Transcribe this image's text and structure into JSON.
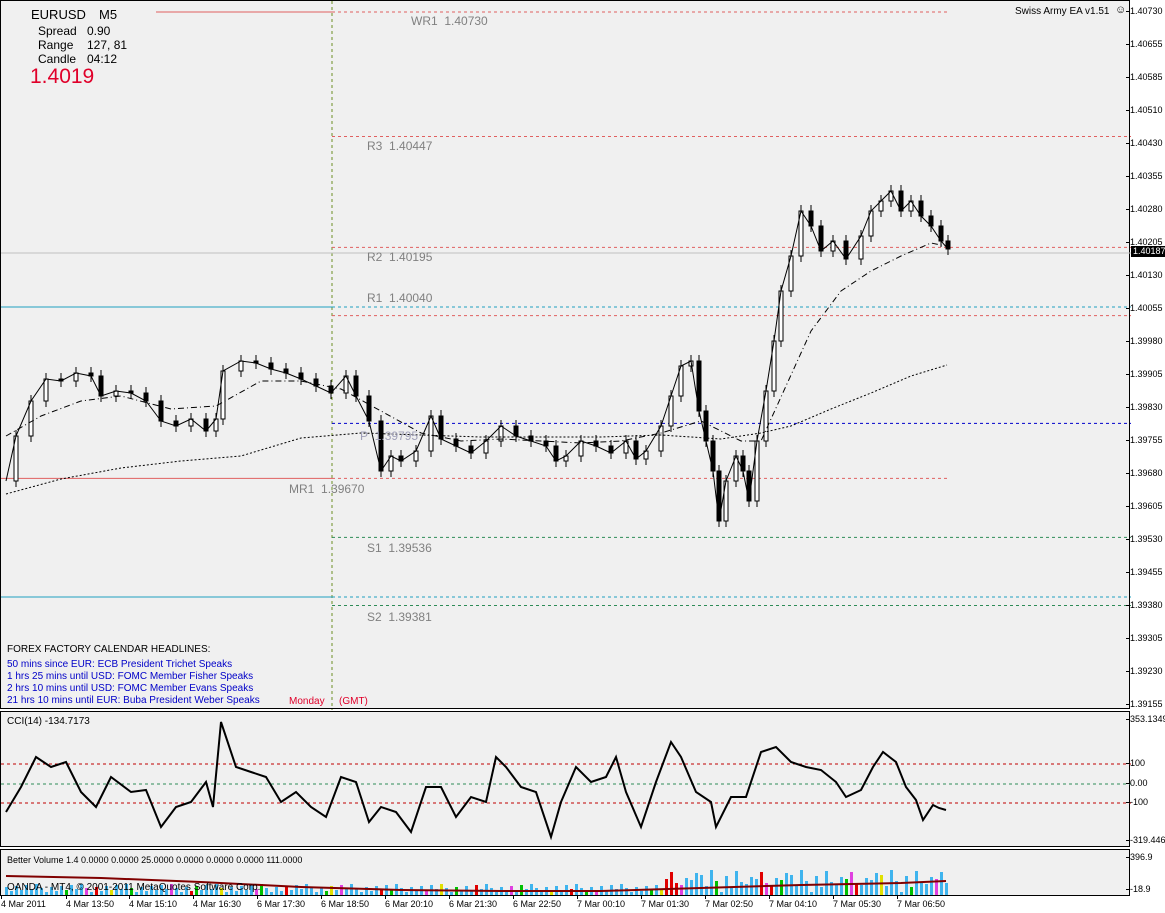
{
  "symbol": "EURUSD",
  "timeframe": "M5",
  "info": {
    "spread_label": "Spread",
    "spread_value": "0.90",
    "range_label": "Range",
    "range_value": "127, 81",
    "candle_label": "Candle",
    "candle_value": "04:12",
    "price": "1.4019"
  },
  "ea_label": "Swiss Army EA v1.51",
  "ea_icon": "smiley-icon",
  "levels": [
    {
      "name": "WR1",
      "value": "1.40730"
    },
    {
      "name": "R3",
      "value": "1.40447"
    },
    {
      "name": "R2",
      "value": "1.40195"
    },
    {
      "name": "R1",
      "value": "1.40040"
    },
    {
      "name": "P",
      "value": "1.39795"
    },
    {
      "name": "MR1",
      "value": "1.39670"
    },
    {
      "name": "S1",
      "value": "1.39536"
    },
    {
      "name": "S2",
      "value": "1.39381"
    }
  ],
  "calendar": {
    "title": "FOREX FACTORY CALENDAR  HEADLINES:",
    "items": [
      "50 mins since EUR: ECB President Trichet Speaks",
      "1 hrs 25 mins until USD: FOMC Member Fisher Speaks",
      "2 hrs 10 mins until USD: FOMC Member Evans Speaks",
      "21 hrs 10 mins until EUR: Buba President Weber Speaks"
    ],
    "day": "Monday",
    "tz": "(GMT)"
  },
  "price_axis": [
    "1.40730",
    "1.40655",
    "1.40585",
    "1.40510",
    "1.40430",
    "1.40355",
    "1.40280",
    "1.40205",
    "1.40130",
    "1.40055",
    "1.39980",
    "1.39905",
    "1.39830",
    "1.39755",
    "1.39680",
    "1.39605",
    "1.39530",
    "1.39455",
    "1.39380",
    "1.39305",
    "1.39230",
    "1.39155"
  ],
  "current_price_badge": "1.40187",
  "cci": {
    "label": "CCI(14) -134.7173",
    "axis": [
      "353.1349",
      "100",
      "0.00",
      "-100",
      "-319.446"
    ]
  },
  "volume": {
    "label": "Better Volume 1.4 0.0000 0.0000 25.0000 0.0000 0.0000 0.0000 111.0000",
    "axis": [
      "396.9",
      "-18.9"
    ],
    "copyright": "OANDA - MT4, © 2001-2011 MetaQuotes Software Corp."
  },
  "time_axis": [
    "4 Mar 2011",
    "4 Mar 13:50",
    "4 Mar 15:10",
    "4 Mar 16:30",
    "6 Mar 17:30",
    "6 Mar 18:50",
    "6 Mar 20:10",
    "6 Mar 21:30",
    "6 Mar 22:50",
    "7 Mar 00:10",
    "7 Mar 01:30",
    "7 Mar 02:50",
    "7 Mar 04:10",
    "7 Mar 05:30",
    "7 Mar 06:50"
  ],
  "colors": {
    "background": "#f0f0f0",
    "resistance_line": "#e06060",
    "support_line": "#2e8b57",
    "pivot_line": "#0000cc",
    "aqua_line": "#1f9fbf",
    "price_red": "#e0002a",
    "cci_line": "#000000",
    "volume_blue": "#3fb4ee"
  }
}
